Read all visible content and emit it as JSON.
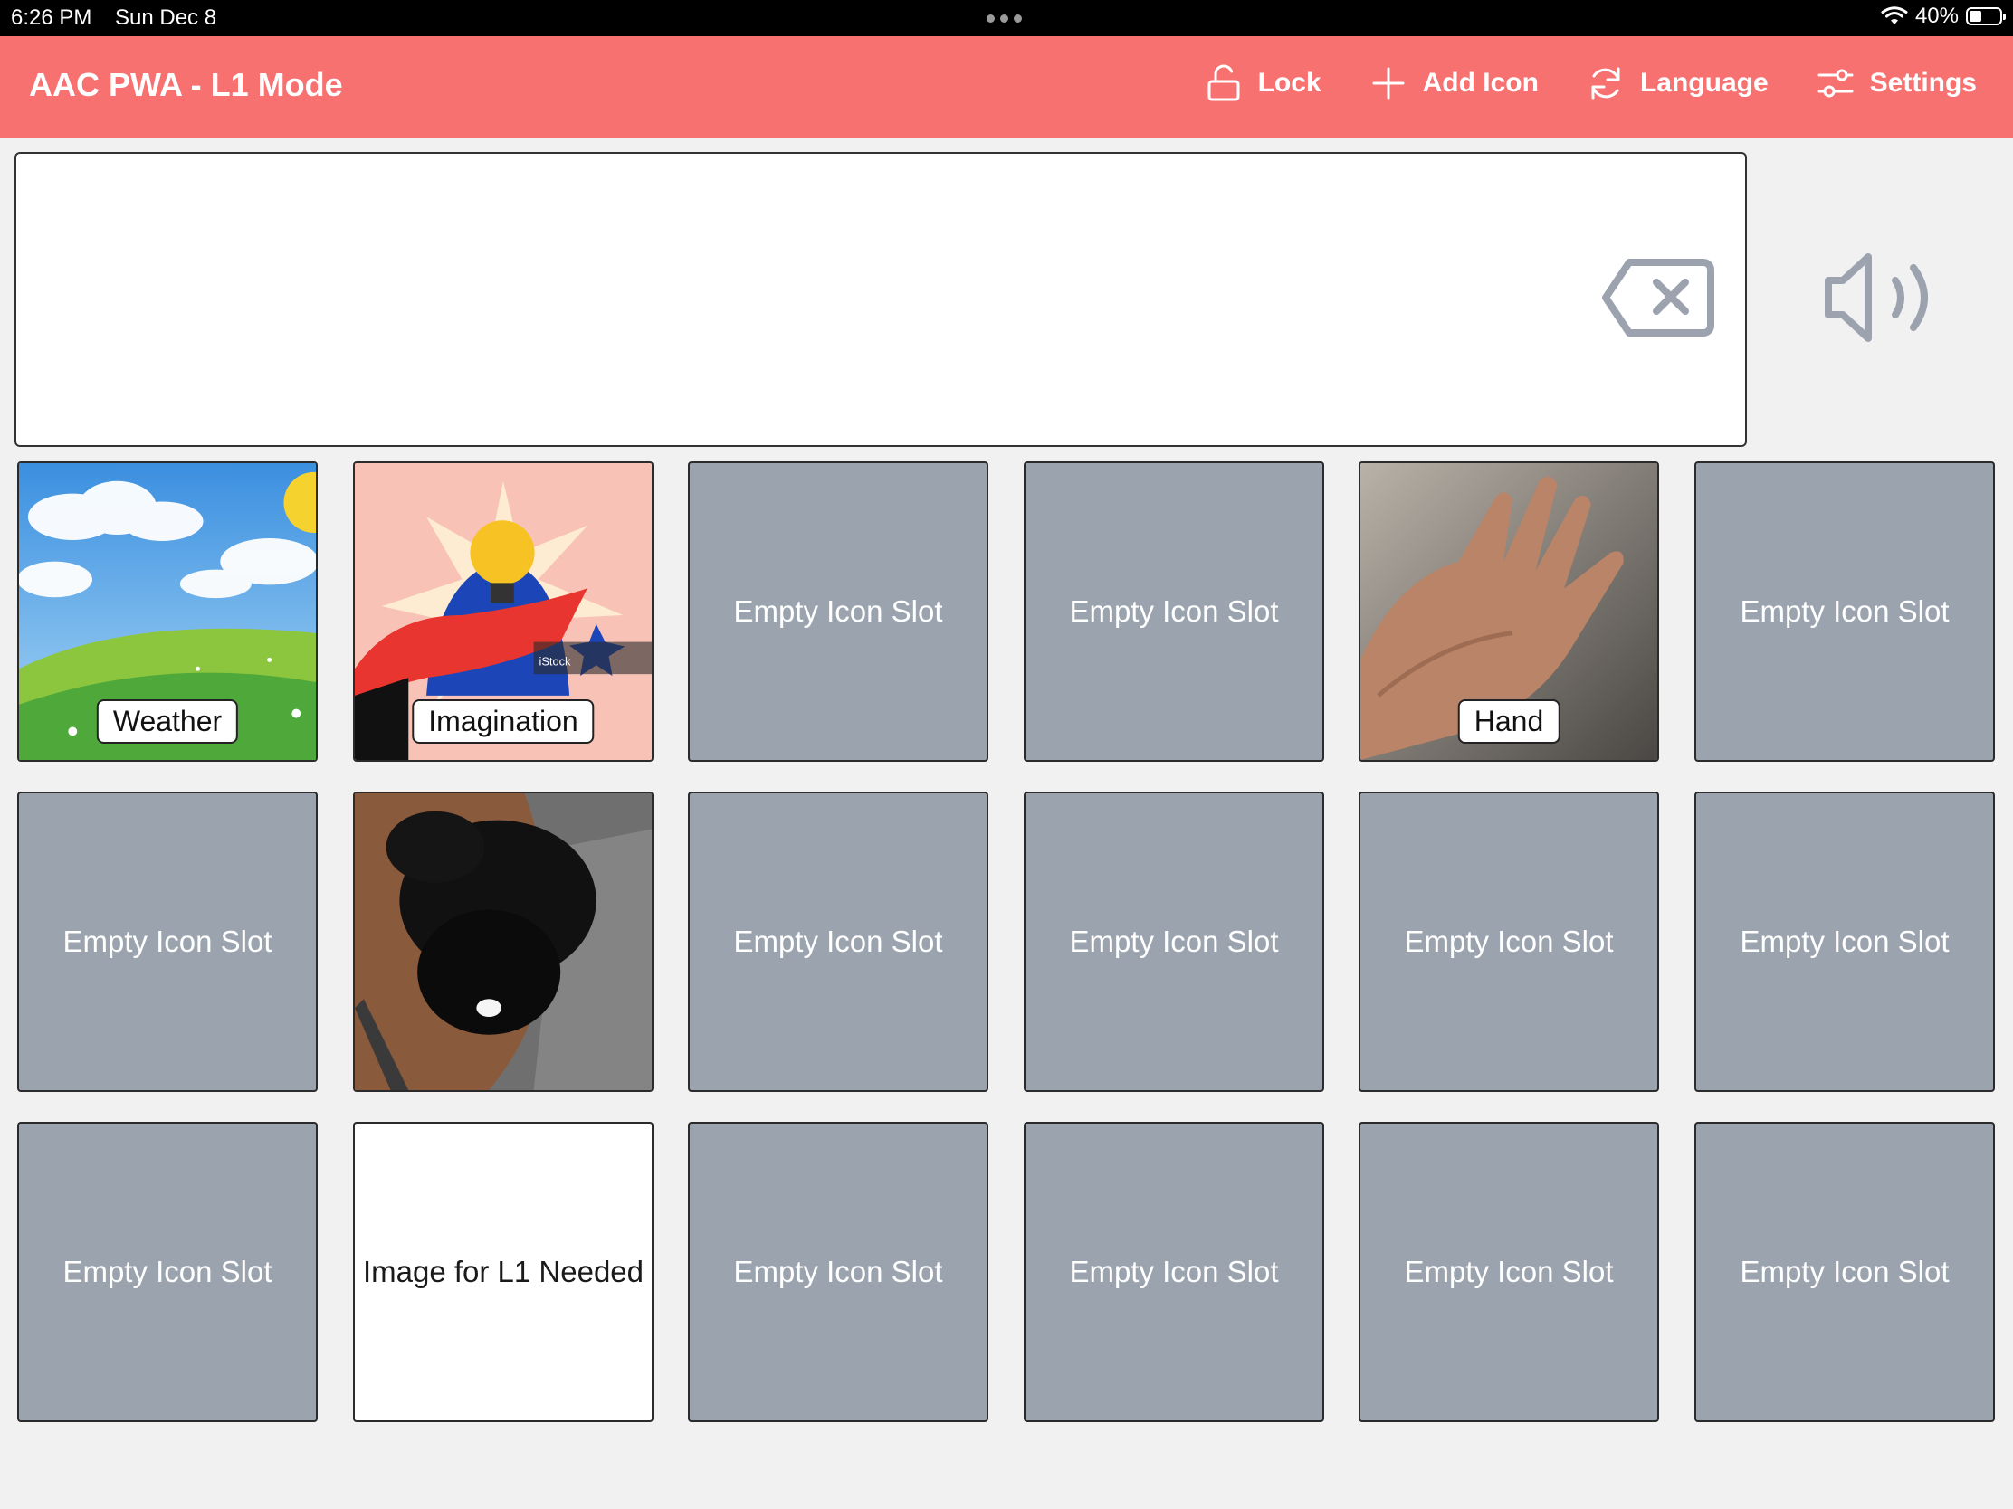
{
  "status_bar": {
    "time": "6:26 PM",
    "date": "Sun Dec 8",
    "battery": "40%",
    "battery_level": 0.4
  },
  "header": {
    "title": "AAC PWA - L1 Mode",
    "actions": [
      {
        "label": "Lock",
        "icon": "unlock-icon"
      },
      {
        "label": "Add Icon",
        "icon": "plus-icon"
      },
      {
        "label": "Language",
        "icon": "refresh-icon"
      },
      {
        "label": "Settings",
        "icon": "sliders-icon"
      }
    ]
  },
  "sentence_bar": {
    "text": "",
    "clear_icon": "backspace-icon",
    "speak_icon": "speaker-icon"
  },
  "tiles": [
    {
      "label": "Weather",
      "image": "weather-picture"
    },
    {
      "label": "Imagination",
      "image": "imagination-picture",
      "watermark": "iStock"
    },
    {
      "label": "Empty Icon Slot"
    },
    {
      "label": "Empty Icon Slot"
    },
    {
      "label": "Hand",
      "image": "hand-picture"
    },
    {
      "label": "Empty Icon Slot"
    },
    {
      "label": "Empty Icon Slot"
    },
    {
      "label": "",
      "image": "cat-picture"
    },
    {
      "label": "Empty Icon Slot"
    },
    {
      "label": "Empty Icon Slot"
    },
    {
      "label": "Empty Icon Slot"
    },
    {
      "label": "Empty Icon Slot"
    },
    {
      "label": "Empty Icon Slot"
    },
    {
      "label": "Image for L1 Needed"
    },
    {
      "label": "Empty Icon Slot"
    },
    {
      "label": "Empty Icon Slot"
    },
    {
      "label": "Empty Icon Slot"
    },
    {
      "label": "Empty Icon Slot"
    }
  ],
  "colors": {
    "header": "#f87171",
    "empty_tile": "#9aa3ae",
    "background": "#f1f1f1"
  }
}
